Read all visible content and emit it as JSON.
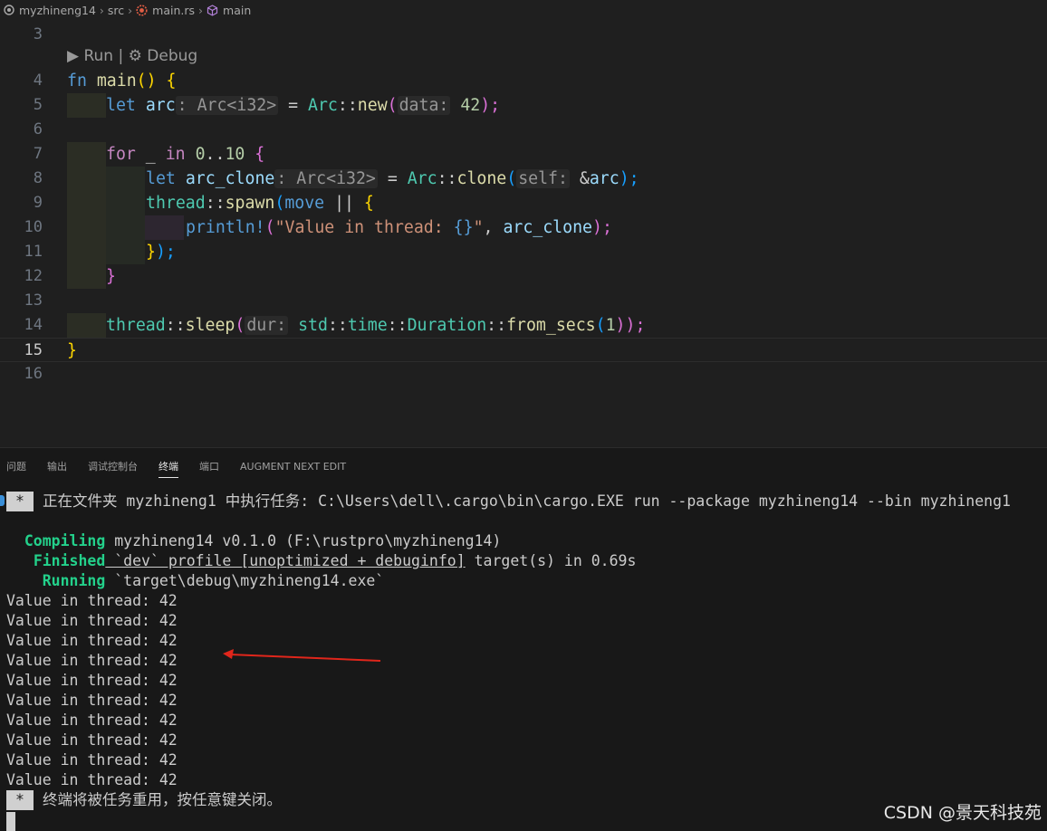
{
  "breadcrumb": {
    "project": "myzhineng14",
    "folder": "src",
    "file": "main.rs",
    "symbol": "main"
  },
  "editor": {
    "codelens": {
      "run": "Run",
      "separator": "|",
      "debug": "Debug"
    },
    "line_numbers": [
      "3",
      "4",
      "5",
      "6",
      "7",
      "8",
      "9",
      "10",
      "11",
      "12",
      "13",
      "14",
      "15",
      "16"
    ],
    "active_line": "15",
    "lines": {
      "l4": {
        "kw": "fn",
        "name": "main",
        "rest": "() {"
      },
      "l5": {
        "let": "let",
        "var": "arc",
        "hint": ": Arc<i32>",
        "eq": " = ",
        "ty": "Arc",
        "sep": "::",
        "fn": "new",
        "open": "(",
        "hint2": "data:",
        "num": "42",
        "close": ");"
      },
      "l7": {
        "kw": "for",
        "rest1": " _ ",
        "in": "in",
        "num1": "0",
        "range": "..",
        "num2": "10",
        "brace": " {"
      },
      "l8": {
        "let": "let",
        "var": "arc_clone",
        "hint": ": Arc<i32>",
        "eq": " = ",
        "ty": "Arc",
        "sep": "::",
        "fn": "clone",
        "open": "(",
        "hint2": "self:",
        "amp": " &",
        "var2": "arc",
        "close": ");"
      },
      "l9": {
        "ns": "thread",
        "sep": "::",
        "fn": "spawn",
        "open": "(",
        "kw": "move",
        "pipes": " ||",
        "brace": " {"
      },
      "l10": {
        "mac": "println!",
        "open": "(",
        "str": "\"Value in thread: ",
        "fmt": "{}",
        "str2": "\"",
        "comma": ", ",
        "var": "arc_clone",
        "close": ");"
      },
      "l11": {
        "close1": "}",
        "close2": ");"
      },
      "l12": {
        "close": "}"
      },
      "l14": {
        "ns": "thread",
        "sep": "::",
        "fn": "sleep",
        "open": "(",
        "hint": "dur:",
        "ns2": "std",
        "sep2": "::",
        "ns3": "time",
        "sep3": "::",
        "ty": "Duration",
        "sep4": "::",
        "fn2": "from_secs",
        "open2": "(",
        "num": "1",
        "close": "));"
      },
      "l15": {
        "close": "}"
      }
    }
  },
  "panel": {
    "tabs": [
      "问题",
      "输出",
      "调试控制台",
      "终端",
      "端口",
      "AUGMENT NEXT EDIT"
    ],
    "active_tab": "终端"
  },
  "terminal": {
    "task_line": "正在文件夹 myzhineng1 中执行任务: C:\\Users\\dell\\.cargo\\bin\\cargo.EXE run --package myzhineng14 --bin myzhineng1",
    "star": "*",
    "compiling": {
      "label": "Compiling",
      "text": " myzhineng14 v0.1.0 (F:\\rustpro\\myzhineng14)"
    },
    "finished": {
      "label": "Finished",
      "tick1": " `dev` profile [unoptimized + debuginfo]",
      "text": " target(s) in 0.69s"
    },
    "running": {
      "label": "Running",
      "text": " `target\\debug\\myzhineng14.exe`"
    },
    "output": [
      "Value in thread: 42",
      "Value in thread: 42",
      "Value in thread: 42",
      "Value in thread: 42",
      "Value in thread: 42",
      "Value in thread: 42",
      "Value in thread: 42",
      "Value in thread: 42",
      "Value in thread: 42",
      "Value in thread: 42"
    ],
    "end_line": "终端将被任务重用，按任意键关闭。"
  },
  "watermark": "CSDN @景天科技苑",
  "annotation": {
    "arrow_color": "#e0261b"
  }
}
